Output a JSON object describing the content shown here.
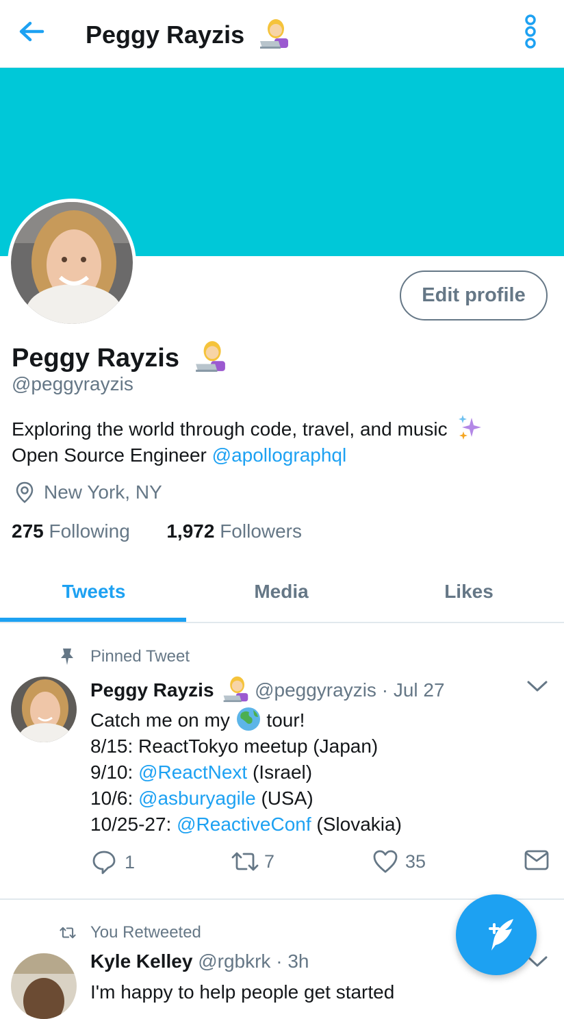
{
  "header": {
    "title": "Peggy Rayzis",
    "back_icon": "arrow-left-icon",
    "more_icon": "vertical-dots-icon"
  },
  "profile": {
    "name": "Peggy Rayzis",
    "handle": "@peggyrayzis",
    "edit_label": "Edit profile",
    "bio_line1": "Exploring the world through code, travel, and music",
    "bio_line2_prefix": "Open Source Engineer ",
    "bio_link": "@apollographql",
    "location": "New York, NY",
    "following_count": "275",
    "following_label": "Following",
    "followers_count": "1,972",
    "followers_label": "Followers"
  },
  "tabs": [
    {
      "label": "Tweets",
      "active": true
    },
    {
      "label": "Media",
      "active": false
    },
    {
      "label": "Likes",
      "active": false
    }
  ],
  "pinned_tweet": {
    "pinned_label": "Pinned Tweet",
    "author_name": "Peggy Rayzis",
    "author_handle": "@peggyrayzis",
    "date": "Jul 27",
    "separator": "·",
    "text_line1_a": "Catch me on my ",
    "text_line1_b": " tour!",
    "text_line2": "8/15: ReactTokyo meetup (Japan)",
    "text_line3_a": "9/10: ",
    "text_line3_link": "@ReactNext",
    "text_line3_b": " (Israel)",
    "text_line4_a": "10/6: ",
    "text_line4_link": "@asburyagile",
    "text_line4_b": " (USA)",
    "text_line5_a": "10/25-27: ",
    "text_line5_link": "@ReactiveConf",
    "text_line5_b": " (Slovakia)",
    "reply_count": "1",
    "retweet_count": "7",
    "like_count": "35"
  },
  "retweet": {
    "retweeted_label": "You Retweeted",
    "author_name": "Kyle Kelley",
    "author_handle": "@rgbkrk",
    "time": "3h",
    "separator": "·",
    "text_line1": "I'm happy to help people get started"
  },
  "colors": {
    "accent": "#1da1f2",
    "banner": "#00c8d8",
    "secondary_text": "#657786",
    "primary_text": "#14171a"
  }
}
